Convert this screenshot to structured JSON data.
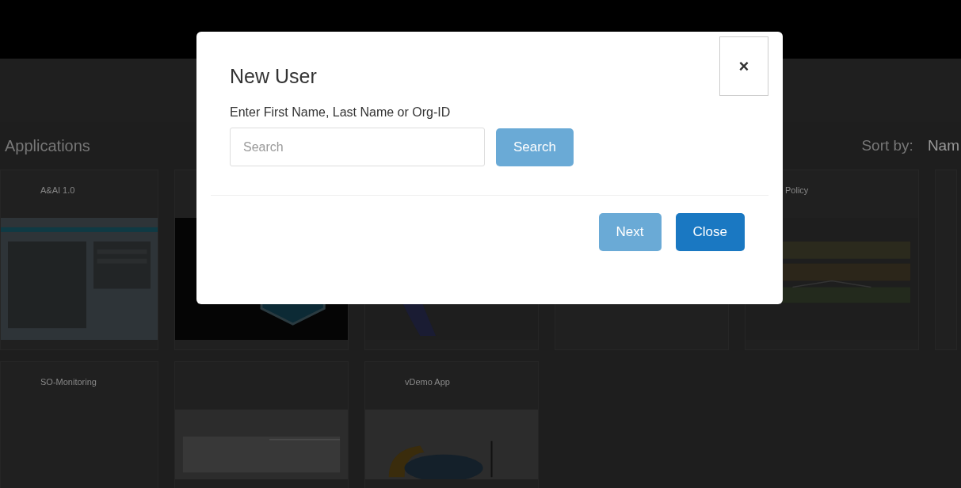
{
  "page": {
    "title": "Applications",
    "sort_label": "Sort by:",
    "sort_value": "Nam"
  },
  "cards": [
    {
      "title": "A&AI 1.0",
      "kind": "picture"
    },
    {
      "kind": "picture"
    },
    {
      "kind": "picture"
    },
    {
      "kind": "plain"
    },
    {
      "title": "Policy",
      "kind": "picture"
    },
    {
      "kind": "plain"
    },
    {
      "title": "SO-Monitoring",
      "kind": "plain"
    },
    {
      "kind": "picture"
    },
    {
      "title": "vDemo App",
      "kind": "picture"
    }
  ],
  "modal": {
    "title": "New User",
    "close_icon": "×",
    "field_label": "Enter First Name, Last Name or Org-ID",
    "search": {
      "placeholder": "Search"
    },
    "search_button": {
      "label": "Search",
      "disabled": true
    },
    "buttons": [
      {
        "label": "Next",
        "disabled": true
      },
      {
        "label": "Close",
        "disabled": false
      }
    ]
  }
}
